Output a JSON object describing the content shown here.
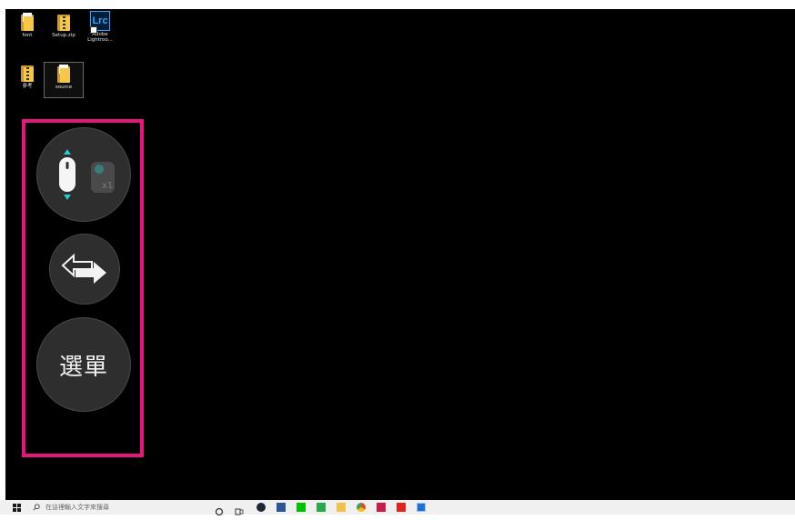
{
  "desktop": {
    "icons": [
      {
        "label": "font",
        "kind": "folder"
      },
      {
        "label": "Setup.zip",
        "kind": "zip"
      },
      {
        "label": "Adobe Lightroo...",
        "kind": "app",
        "glyph_text": "Lrc",
        "brand_color": "#31a8ff"
      },
      {
        "label": "參考",
        "kind": "zip"
      },
      {
        "label": "source",
        "kind": "folder",
        "selected": true
      }
    ]
  },
  "control_panel": {
    "highlight_color": "#e4187c",
    "mouse_button": {
      "icon": "mouse-scroll-icon",
      "badge_icon": "touch-one-finger-icon",
      "badge_text": "x1"
    },
    "switch_button": {
      "icon": "swap-arrows-icon"
    },
    "menu_button": {
      "label": "選單"
    }
  },
  "taskbar": {
    "search_placeholder": "在這裡輸入文字來搜尋",
    "apps": [
      {
        "name": "cortana-icon",
        "color": "#333333"
      },
      {
        "name": "task-view-icon",
        "color": "#333333"
      },
      {
        "name": "steam-icon",
        "color": "#1b2838"
      },
      {
        "name": "file-explorer-pinned-icon",
        "color": "#2b5797"
      },
      {
        "name": "line-app-icon",
        "color": "#00c300"
      },
      {
        "name": "app-green-icon",
        "color": "#2aa84a"
      },
      {
        "name": "folder-icon",
        "color": "#f2c14a"
      },
      {
        "name": "chrome-icon",
        "color": "#4285f4"
      },
      {
        "name": "indesign-icon",
        "color": "#cc1a4a"
      },
      {
        "name": "acrobat-icon",
        "color": "#e0261b"
      },
      {
        "name": "app-blue-icon",
        "color": "#1f6fd8"
      }
    ]
  }
}
